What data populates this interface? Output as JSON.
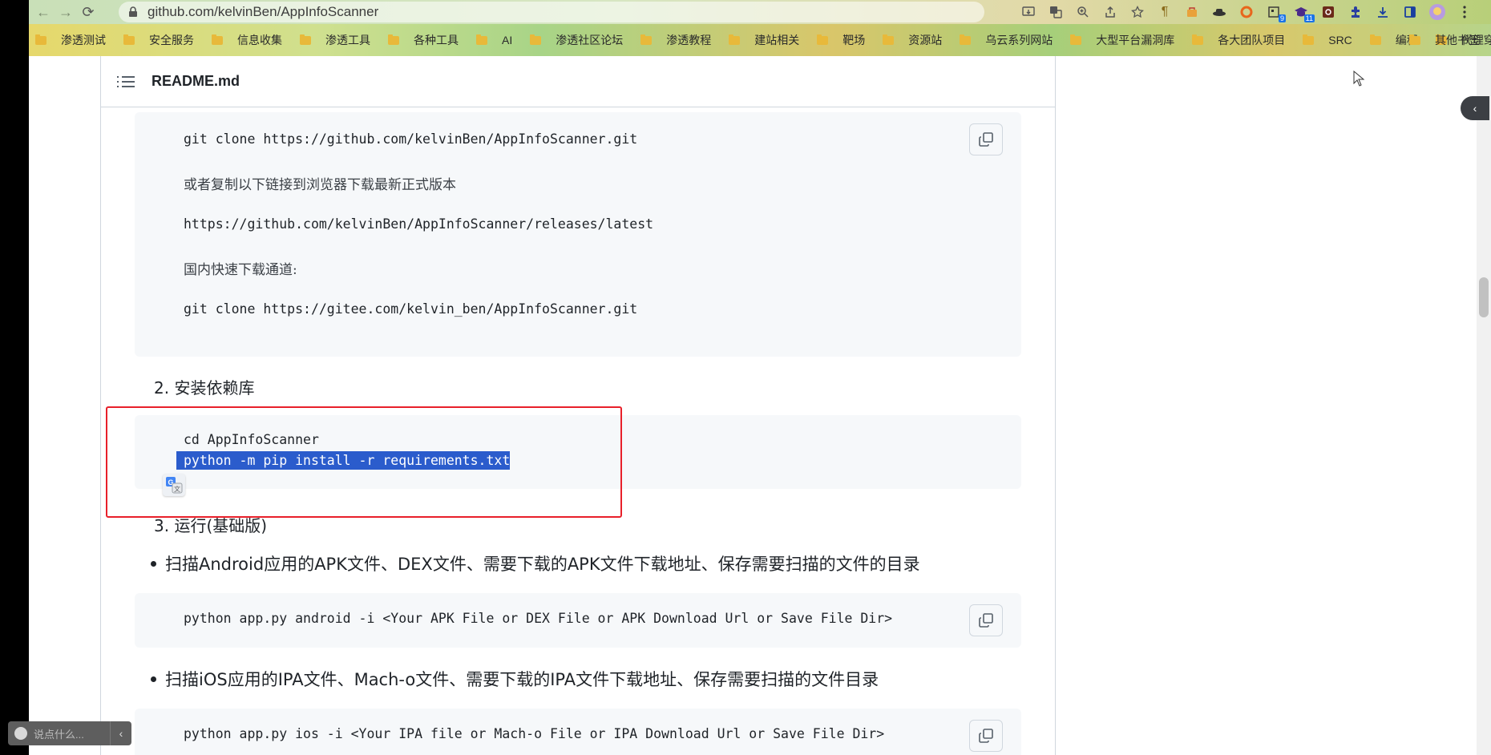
{
  "browser": {
    "url": "github.com/kelvinBen/AppInfoScanner",
    "toolbar_icons": [
      "install-icon",
      "translate-icon",
      "zoom-icon",
      "share-icon",
      "bookmark-star-icon",
      "paragraph-ext-icon",
      "ext-bag-icon",
      "ext-hat-icon",
      "ext-ring-icon",
      "ext-qr-icon",
      "ext-grad-icon",
      "ext-office-icon",
      "extensions-puzzle-icon",
      "download-icon",
      "sidebar-icon",
      "profile-avatar-icon",
      "menu-kebab-icon"
    ],
    "ext_badges": {
      "qr": "9",
      "grad": "11"
    }
  },
  "bookmarks": {
    "items": [
      "渗透测试",
      "安全服务",
      "信息收集",
      "渗透工具",
      "各种工具",
      "AI",
      "渗透社区论坛",
      "渗透教程",
      "建站相关",
      "靶场",
      "资源站",
      "乌云系列网站",
      "大型平台漏洞库",
      "各大团队项目",
      "SRC",
      "编程",
      "代理穿透"
    ],
    "other": "其他书签"
  },
  "readme": {
    "title": "README.md",
    "block1": {
      "line1": "git clone https://github.com/kelvinBen/AppInfoScanner.git",
      "line2": "或者复制以下链接到浏览器下载最新正式版本",
      "line3": "https://github.com/kelvinBen/AppInfoScanner/releases/latest",
      "line4": "国内快速下载通道:",
      "line5": "git clone https://gitee.com/kelvin_ben/AppInfoScanner.git"
    },
    "step2": "2. 安装依赖库",
    "block2": {
      "line1": "cd AppInfoScanner",
      "line2": "python -m pip install -r requirements.txt"
    },
    "step3": "3. 运行(基础版)",
    "bullet1": "扫描Android应用的APK文件、DEX文件、需要下载的APK文件下载地址、保存需要扫描的文件的目录",
    "block3": "python app.py android -i <Your APK File or DEX File or APK Download Url or Save File Dir>",
    "bullet2": "扫描iOS应用的IPA文件、Mach-o文件、需要下载的IPA文件下载地址、保存需要扫描的文件目录",
    "block4": "python app.py ios -i <Your IPA file or Mach-o File or IPA Download Url or Save File Dir>"
  },
  "comment": {
    "placeholder": "说点什么..."
  },
  "colors": {
    "selection": "#2b5ccc",
    "annotation_box": "#e8202a",
    "code_bg": "#f6f8fa"
  }
}
